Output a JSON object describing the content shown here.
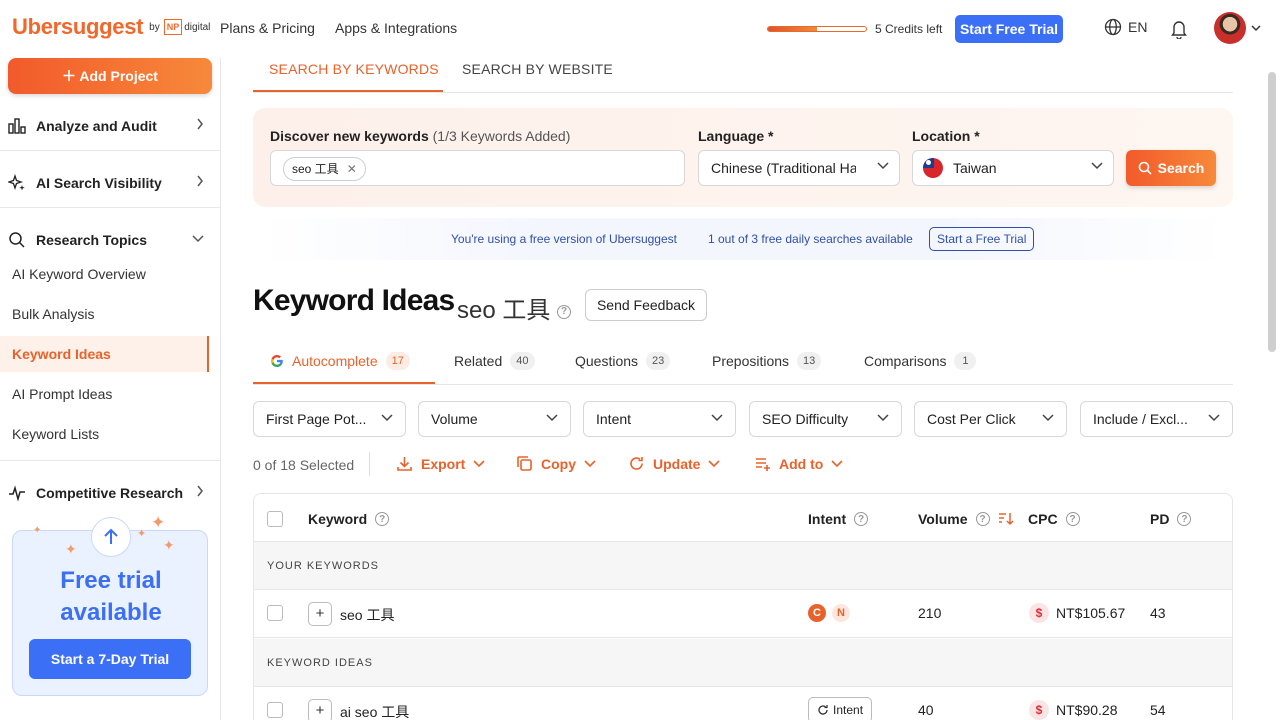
{
  "brand": {
    "logo": "Ubersuggest",
    "by": "by",
    "np": "NP",
    "digital": "digital"
  },
  "topnav": {
    "plans": "Plans & Pricing",
    "apps": "Apps & Integrations",
    "credits": "5 Credits left",
    "credits_fraction": 0.5,
    "trial_button": "Start Free Trial",
    "language": "EN"
  },
  "sidebar": {
    "add_project": "Add Project",
    "analyze": "Analyze and Audit",
    "ai_search": "AI Search Visibility",
    "research": "Research Topics",
    "items": [
      "AI Keyword Overview",
      "Bulk Analysis",
      "Keyword Ideas",
      "AI Prompt Ideas",
      "Keyword Lists"
    ],
    "competitive": "Competitive Research",
    "promo_title_1": "Free trial",
    "promo_title_2": "available",
    "promo_button": "Start a 7-Day Trial"
  },
  "main": {
    "tab_keywords": "SEARCH BY KEYWORDS",
    "tab_website": "SEARCH BY WEBSITE",
    "discover_label": "Discover new keywords",
    "discover_sub": "(1/3 Keywords Added)",
    "chip": "seo 工具",
    "language_label": "Language *",
    "language_value": "Chinese (Traditional Han)",
    "location_label": "Location *",
    "location_value": "Taiwan",
    "search_button": "Search",
    "free_version": "You're using a free version of Ubersuggest",
    "free_searches": "1 out of 3 free daily searches available",
    "free_trial_btn": "Start a Free Trial",
    "title": "Keyword Ideas",
    "title_keyword": "seo 工具",
    "feedback": "Send Feedback",
    "ktabs": [
      {
        "label": "Autocomplete",
        "count": "17"
      },
      {
        "label": "Related",
        "count": "40"
      },
      {
        "label": "Questions",
        "count": "23"
      },
      {
        "label": "Prepositions",
        "count": "13"
      },
      {
        "label": "Comparisons",
        "count": "1"
      }
    ],
    "filters": [
      "First Page Pot...",
      "Volume",
      "Intent",
      "SEO Difficulty",
      "Cost Per Click",
      "Include / Excl..."
    ],
    "selected": "0 of 18 Selected",
    "actions": {
      "export": "Export",
      "copy": "Copy",
      "update": "Update",
      "add": "Add to"
    }
  },
  "table": {
    "headers": {
      "keyword": "Keyword",
      "intent": "Intent",
      "volume": "Volume",
      "cpc": "CPC",
      "pd": "PD"
    },
    "group_yours": "YOUR KEYWORDS",
    "group_ideas": "KEYWORD IDEAS",
    "rows": [
      {
        "keyword": "seo 工具",
        "intent_c": "C",
        "intent_n": "N",
        "volume": "210",
        "cpc": "NT$105.67",
        "pd": "43"
      },
      {
        "keyword": "ai seo 工具",
        "intent_btn": "Intent",
        "volume": "40",
        "cpc": "NT$90.28",
        "pd": "54"
      }
    ]
  },
  "colors": {
    "accent": "#e8622b",
    "blue": "#3b6ff5"
  }
}
